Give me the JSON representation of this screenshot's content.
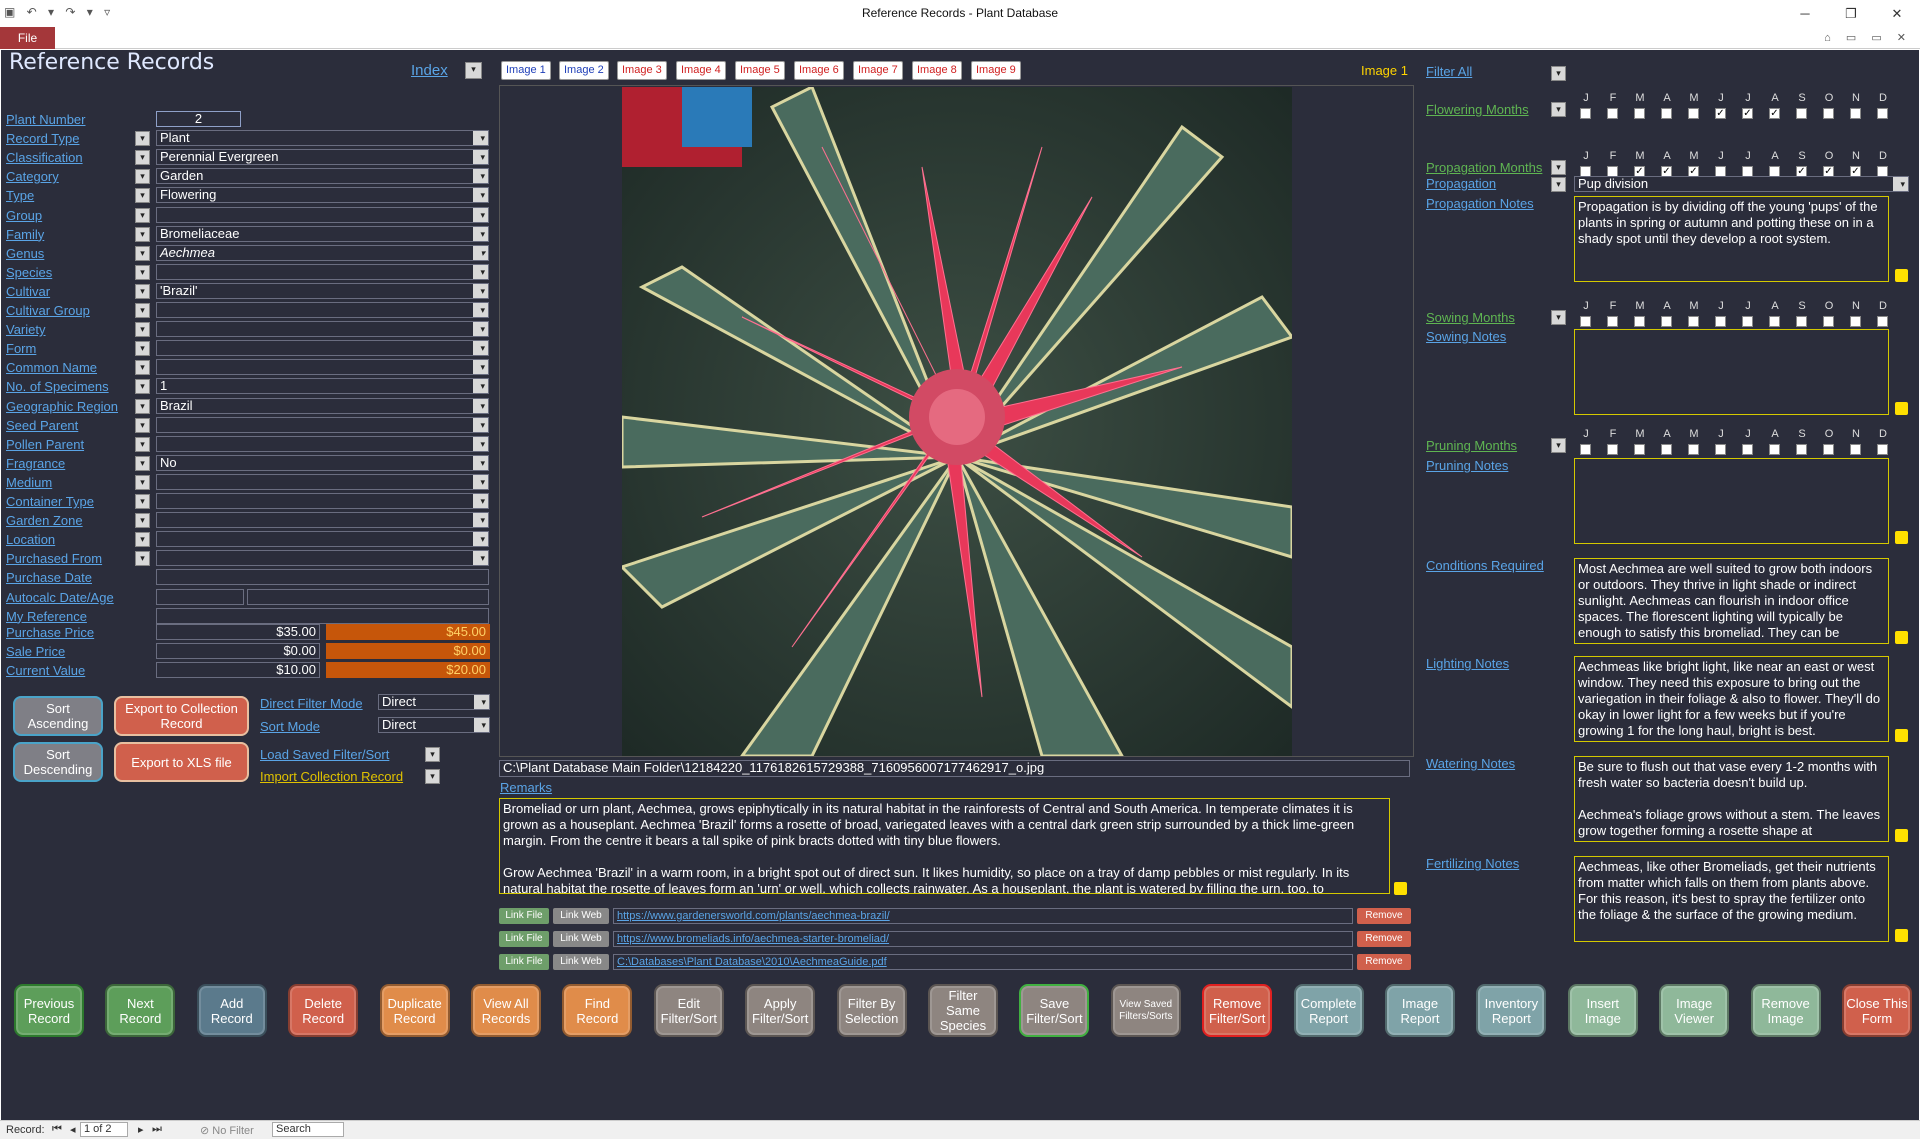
{
  "window": {
    "title": "Reference Records  -  Plant Database",
    "file_tab": "File"
  },
  "form": {
    "title": "Reference Records",
    "index_label": "Index"
  },
  "left_fields": [
    {
      "label": "Plant Number",
      "value": "2",
      "type": "text"
    },
    {
      "label": "Record Type",
      "value": "Plant",
      "type": "combo"
    },
    {
      "label": "Classification",
      "value": "Perennial Evergreen",
      "type": "combo"
    },
    {
      "label": "Category",
      "value": "Garden",
      "type": "combo"
    },
    {
      "label": "Type",
      "value": "Flowering",
      "type": "combo"
    },
    {
      "label": "Group",
      "value": "",
      "type": "combo"
    },
    {
      "label": "Family",
      "value": "Bromeliaceae",
      "type": "combo"
    },
    {
      "label": "Genus",
      "value": "Aechmea",
      "type": "combo",
      "italic": true
    },
    {
      "label": "Species",
      "value": "",
      "type": "combo"
    },
    {
      "label": "Cultivar",
      "value": "'Brazil'",
      "type": "combo"
    },
    {
      "label": "Cultivar Group",
      "value": "",
      "type": "combo"
    },
    {
      "label": "Variety",
      "value": "",
      "type": "combo"
    },
    {
      "label": "Form",
      "value": "",
      "type": "combo"
    },
    {
      "label": "Common Name",
      "value": "",
      "type": "combo"
    },
    {
      "label": "No. of Specimens",
      "value": "1",
      "type": "combo"
    },
    {
      "label": "Geographic Region",
      "value": "Brazil",
      "type": "combo"
    },
    {
      "label": "Seed Parent",
      "value": "",
      "type": "combo"
    },
    {
      "label": "Pollen Parent",
      "value": "",
      "type": "combo"
    },
    {
      "label": "Fragrance",
      "value": "No",
      "type": "combo"
    },
    {
      "label": "Medium",
      "value": "",
      "type": "combo"
    },
    {
      "label": "Container Type",
      "value": "",
      "type": "combo"
    },
    {
      "label": "Garden Zone",
      "value": "",
      "type": "combo"
    },
    {
      "label": "Location",
      "value": "",
      "type": "combo"
    },
    {
      "label": "Purchased From",
      "value": "",
      "type": "combo"
    },
    {
      "label": "Purchase Date",
      "value": "",
      "type": "plain"
    },
    {
      "label": "Autocalc Date/Age",
      "value": "",
      "type": "split"
    },
    {
      "label": "My Reference",
      "value": "",
      "type": "plain"
    }
  ],
  "prices": [
    {
      "label": "Purchase Price",
      "value": "$35.00",
      "alt": "$45.00"
    },
    {
      "label": "Sale Price",
      "value": "$0.00",
      "alt": "$0.00"
    },
    {
      "label": "Current Value",
      "value": "$10.00",
      "alt": "$20.00"
    }
  ],
  "side_buttons": {
    "sort_asc": "Sort Ascending",
    "sort_desc": "Sort Descending",
    "export_collection": "Export to Collection Record",
    "export_xls": "Export to XLS file"
  },
  "modes": {
    "direct_filter_label": "Direct Filter Mode",
    "direct_filter_value": "Direct",
    "sort_mode_label": "Sort Mode",
    "sort_mode_value": "Direct",
    "load_saved": "Load Saved Filter/Sort",
    "import_collection": "Import Collection Record"
  },
  "image_tabs": [
    "Image 1",
    "Image 2",
    "Image 3",
    "Image 4",
    "Image 5",
    "Image 6",
    "Image 7",
    "Image 8",
    "Image 9"
  ],
  "current_image": "Image 1",
  "image_path": "C:\\Plant Database Main Folder\\12184220_1176182615729388_7160956007177462917_o.jpg",
  "remarks": {
    "label": "Remarks",
    "text1": "Bromeliad or urn plant, Aechmea, grows epiphytically in its natural habitat in the rainforests of Central and South America. In temperate climates it is grown as a houseplant. Aechmea 'Brazil' forms a rosette of broad, variegated leaves with a central dark green strip surrounded by a thick lime-green margin. From the centre it bears a tall spike of pink bracts dotted with tiny blue flowers.",
    "text2": "Grow Aechmea 'Brazil' in a warm room, in a bright spot out of direct sun. It likes humidity, so place on a tray of damp pebbles or mist regularly. In its natural habitat the rosette of leaves form an 'urn' or well, which collects rainwater. As a houseplant, the plant is watered by filling the urn, too, to"
  },
  "links": [
    {
      "file": "Link File",
      "web": "Link Web",
      "url": "https://www.gardenersworld.com/plants/aechmea-brazil/",
      "remove": "Remove"
    },
    {
      "file": "Link File",
      "web": "Link Web",
      "url": "https://www.bromeliads.info/aechmea-starter-bromeliad/",
      "remove": "Remove"
    },
    {
      "file": "Link File",
      "web": "Link Web",
      "url": "C:\\Databases\\Plant Database\\2010\\AechmeaGuide.pdf",
      "remove": "Remove"
    }
  ],
  "right": {
    "filter_all": "Filter All",
    "months": [
      "J",
      "F",
      "M",
      "A",
      "M",
      "J",
      "J",
      "A",
      "S",
      "O",
      "N",
      "D"
    ],
    "flowering": {
      "label": "Flowering Months",
      "checked": [
        false,
        false,
        false,
        false,
        false,
        true,
        true,
        true,
        false,
        false,
        false,
        false
      ]
    },
    "propagation_months": {
      "label": "Propagation Months",
      "checked": [
        false,
        false,
        true,
        true,
        true,
        false,
        false,
        false,
        true,
        true,
        true,
        false
      ]
    },
    "propagation": {
      "label": "Propagation",
      "value": "Pup division"
    },
    "propagation_notes": {
      "label": "Propagation Notes",
      "text": "Propagation is by dividing off the young 'pups' of the plants in spring or autumn and potting these on in a shady spot until they develop a root system."
    },
    "sowing_months": {
      "label": "Sowing Months",
      "checked": [
        false,
        false,
        false,
        false,
        false,
        false,
        false,
        false,
        false,
        false,
        false,
        false
      ]
    },
    "sowing_notes": {
      "label": "Sowing Notes",
      "text": ""
    },
    "pruning_months": {
      "label": "Pruning Months",
      "checked": [
        false,
        false,
        false,
        false,
        false,
        false,
        false,
        false,
        false,
        false,
        false,
        false
      ]
    },
    "pruning_notes": {
      "label": "Pruning Notes",
      "text": ""
    },
    "conditions": {
      "label": "Conditions Required",
      "text": "Most Aechmea are well suited to grow both indoors or outdoors. They thrive in light shade or indirect sunlight. Aechmeas can flourish in indoor office spaces. The florescent lighting will typically be enough to satisfy this bromeliad. They can be"
    },
    "lighting": {
      "label": "Lighting Notes",
      "text": "Aechmeas like bright light, like near an east or west window. They need this exposure to bring out the variegation in their foliage & also to flower. They'll do okay in lower light for a few weeks but if you're growing 1 for the long haul, bright is best."
    },
    "watering": {
      "label": "Watering Notes",
      "text": "Be sure to flush out that vase every 1-2 months with fresh water so bacteria doesn't build up.\n\nAechmea's foliage grows without a stem. The leaves grow together forming a rosette shape at"
    },
    "fertilizing": {
      "label": "Fertilizing Notes",
      "text": "Aechmeas, like other Bromeliads, get their nutrients from matter which falls on them from plants above. For this reason, it's best to spray the fertilizer onto the foliage & the surface of the growing medium."
    }
  },
  "bottom_buttons": [
    {
      "label": "Previous Record",
      "color": "#5d9e5a",
      "name": "previous-record-button"
    },
    {
      "label": "Next Record",
      "color": "#5d9e5a",
      "name": "next-record-button"
    },
    {
      "label": "Add Record",
      "color": "#5b7a8c",
      "name": "add-record-button"
    },
    {
      "label": "Delete Record",
      "color": "#d0604c",
      "name": "delete-record-button"
    },
    {
      "label": "Duplicate Record",
      "color": "#e08c4a",
      "name": "duplicate-record-button"
    },
    {
      "label": "View All Records",
      "color": "#e08c4a",
      "name": "view-all-records-button"
    },
    {
      "label": "Find Record",
      "color": "#e08c4a",
      "name": "find-record-button"
    },
    {
      "label": "Edit Filter/Sort",
      "color": "#8e8580",
      "name": "edit-filter-sort-button"
    },
    {
      "label": "Apply Filter/Sort",
      "color": "#8e8580",
      "name": "apply-filter-sort-button"
    },
    {
      "label": "Filter By Selection",
      "color": "#8e8580",
      "name": "filter-by-selection-button"
    },
    {
      "label": "Filter Same Species",
      "color": "#8e8580",
      "name": "filter-same-species-button"
    },
    {
      "label": "Save Filter/Sort",
      "color": "#8e8580",
      "name": "save-filter-sort-button"
    },
    {
      "label": "View Saved Filters/Sorts",
      "color": "#8e8580",
      "name": "view-saved-filters-button",
      "small": true
    },
    {
      "label": "Remove Filter/Sort",
      "color": "#d0604c",
      "name": "remove-filter-sort-button"
    },
    {
      "label": "Complete Report",
      "color": "#7fa3a8",
      "name": "complete-report-button"
    },
    {
      "label": "Image Report",
      "color": "#7fa3a8",
      "name": "image-report-button"
    },
    {
      "label": "Inventory Report",
      "color": "#7fa3a8",
      "name": "inventory-report-button"
    },
    {
      "label": "Insert Image",
      "color": "#8fb89a",
      "name": "insert-image-button"
    },
    {
      "label": "Image Viewer",
      "color": "#8fb89a",
      "name": "image-viewer-button"
    },
    {
      "label": "Remove Image",
      "color": "#8fb89a",
      "name": "remove-image-button"
    },
    {
      "label": "Close This Form",
      "color": "#d0604c",
      "name": "close-form-button"
    }
  ],
  "status": {
    "record_label": "Record:",
    "position": "1 of 2",
    "filter": "No Filter",
    "search": "Search"
  },
  "colors": {
    "form_bg": "#2b2d3b",
    "link": "#5aa4e6",
    "green_link": "#5fb552",
    "memo_border": "#d4c900",
    "price_alt": "#c6560a"
  }
}
